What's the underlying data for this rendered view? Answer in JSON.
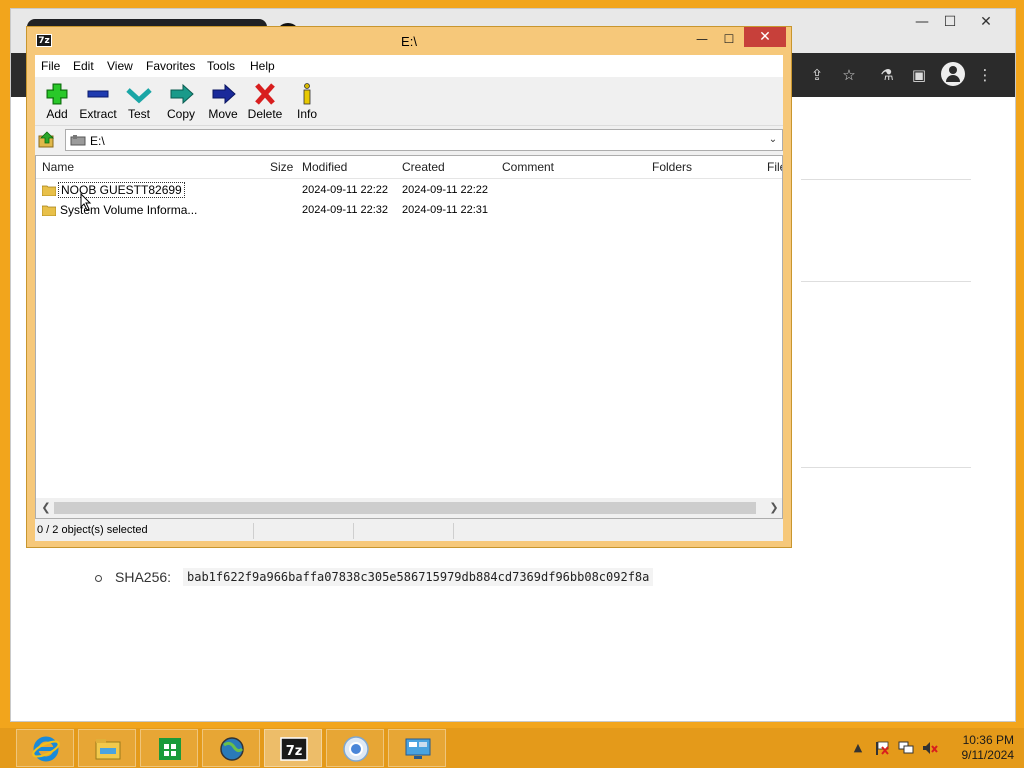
{
  "browser": {
    "window_controls": {
      "minimize": "—",
      "maximize": "☐",
      "close": "✕"
    },
    "hash_line": {
      "label": "SHA256:",
      "value": "bab1f622f9a966baffa07838c305e586715979db884cd7369df96bb08c092f8a"
    }
  },
  "sevenzip": {
    "title": "E:\\",
    "app_icon_text": "7z",
    "controls": {
      "minimize": "—",
      "maximize": "☐",
      "close": "✕"
    },
    "menu": [
      "File",
      "Edit",
      "View",
      "Favorites",
      "Tools",
      "Help"
    ],
    "toolbar": [
      {
        "label": "Add",
        "icon": "add-icon"
      },
      {
        "label": "Extract",
        "icon": "extract-icon"
      },
      {
        "label": "Test",
        "icon": "test-icon"
      },
      {
        "label": "Copy",
        "icon": "copy-icon"
      },
      {
        "label": "Move",
        "icon": "move-icon"
      },
      {
        "label": "Delete",
        "icon": "delete-icon"
      },
      {
        "label": "Info",
        "icon": "info-icon"
      }
    ],
    "address": "E:\\",
    "columns": [
      "Name",
      "Size",
      "Modified",
      "Created",
      "Comment",
      "Folders",
      "File"
    ],
    "rows": [
      {
        "name": "NOOB GUESTT82699",
        "size": "",
        "modified": "2024-09-11 22:22",
        "created": "2024-09-11 22:22"
      },
      {
        "name": "System Volume Informa...",
        "size": "",
        "modified": "2024-09-11 22:32",
        "created": "2024-09-11 22:31"
      }
    ],
    "status": "0 / 2 object(s) selected"
  },
  "taskbar": {
    "apps": [
      "internet-explorer",
      "file-explorer",
      "store",
      "browser-globe",
      "7-zip",
      "chrome",
      "remote-desktop"
    ],
    "active_app": "7-zip",
    "sevenzip_text": "7z",
    "clock_time": "10:36 PM",
    "clock_date": "9/11/2024",
    "tray_arrow": "▲"
  },
  "colors": {
    "desktop": "#f2a51c",
    "window_frame": "#f6c87a",
    "close_button": "#c7403a",
    "taskbar": "#e49a1a"
  }
}
